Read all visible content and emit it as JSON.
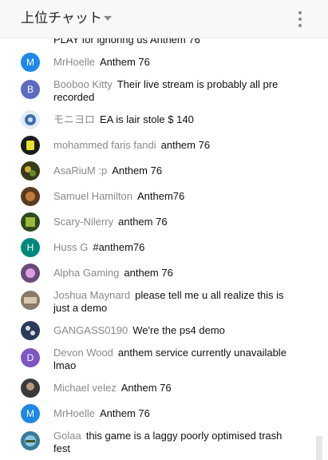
{
  "header": {
    "title": "上位チャット",
    "dropdown_icon": "caret-down-icon",
    "menu_icon": "more-vert-icon"
  },
  "partial_message": "PLAY for ignoring us Anthem 76",
  "messages": [
    {
      "author": "MrHoelle",
      "text": "Anthem 76",
      "avatar_letter": "M",
      "avatar_color": "#1e88e5"
    },
    {
      "author": "Booboo Kitty",
      "text": "Their live stream is probably all pre recorded",
      "avatar_letter": "B",
      "avatar_color": "#5c6bc0"
    },
    {
      "author": "モニヨロ",
      "text": "EA is lair stole  $ 140",
      "avatar_letter": "",
      "avatar_color": "#e3ecf6"
    },
    {
      "author": "mohammed faris fandi",
      "text": "anthem 76",
      "avatar_letter": "",
      "avatar_color": "#1b1b1b"
    },
    {
      "author": "AsaRiuM :p",
      "text": "Anthem 76",
      "avatar_letter": "",
      "avatar_color": "#3a3a1a"
    },
    {
      "author": "Samuel Hamilton",
      "text": "Anthem76",
      "avatar_letter": "",
      "avatar_color": "#5a3a1e"
    },
    {
      "author": "Scary-Nilerry",
      "text": "anthem 76",
      "avatar_letter": "",
      "avatar_color": "#2d4a1e"
    },
    {
      "author": "Huss G",
      "text": "#anthem76",
      "avatar_letter": "H",
      "avatar_color": "#00897b"
    },
    {
      "author": "Alpha Gaming",
      "text": "anthem 76",
      "avatar_letter": "",
      "avatar_color": "#6a4a7a"
    },
    {
      "author": "Joshua Maynard",
      "text": "please tell me u all realize this is just a demo",
      "avatar_letter": "",
      "avatar_color": "#8a7a6a"
    },
    {
      "author": "GANGASS0190",
      "text": "We're the ps4 demo",
      "avatar_letter": "",
      "avatar_color": "#2a3a5a"
    },
    {
      "author": "Devon Wood",
      "text": "anthem service currently unavailable lmao",
      "avatar_letter": "D",
      "avatar_color": "#7e57c2"
    },
    {
      "author": "Michael velez",
      "text": "Anthem 76",
      "avatar_letter": "",
      "avatar_color": "#3a3a3a"
    },
    {
      "author": "MrHoelle",
      "text": "Anthem 76",
      "avatar_letter": "M",
      "avatar_color": "#1e88e5"
    },
    {
      "author": "Golaa",
      "text": "this game is a laggy poorly optimised trash fest",
      "avatar_letter": "",
      "avatar_color": "#3a7a9a"
    }
  ]
}
